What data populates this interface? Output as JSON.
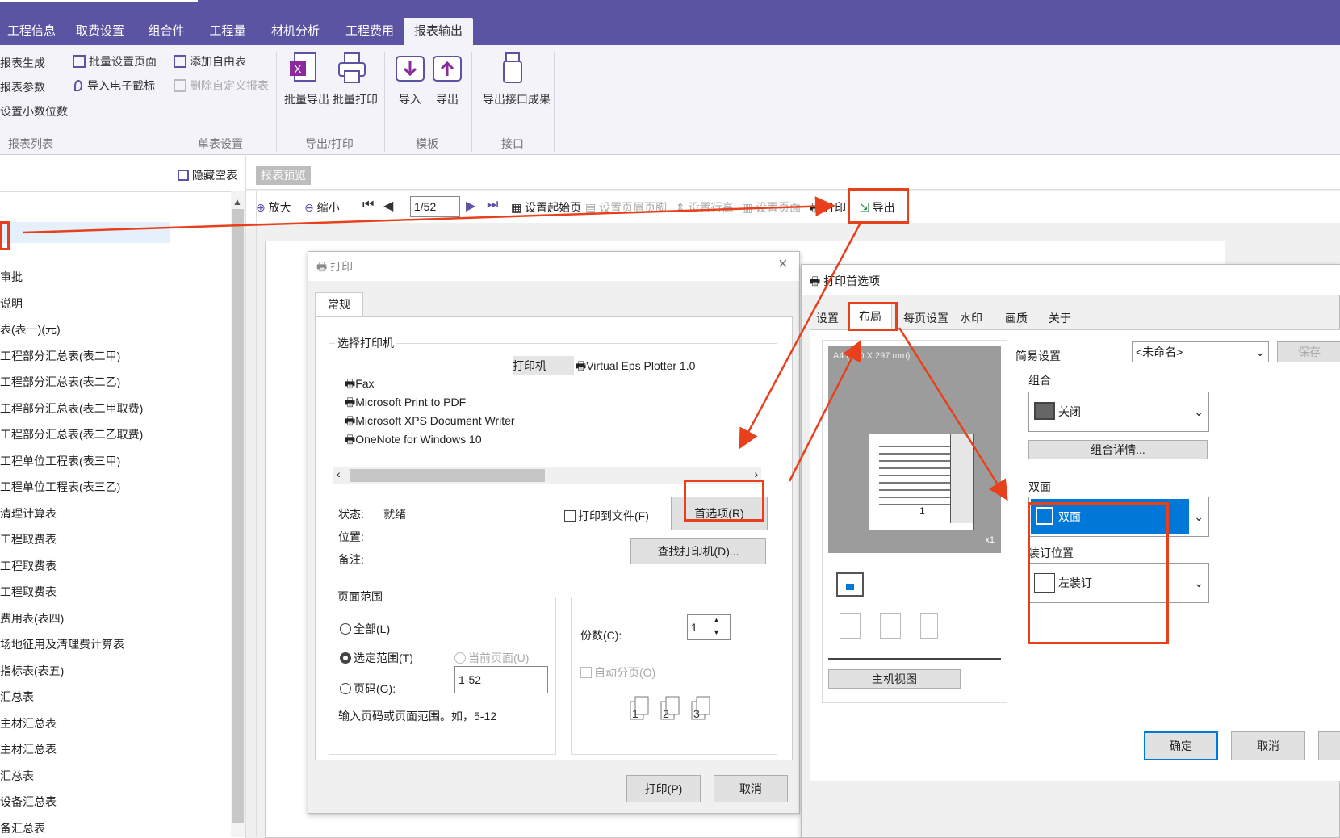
{
  "ribbon": {
    "tabs": [
      "工程信息",
      "取费设置",
      "组合件",
      "工程量",
      "材机分析",
      "工程费用",
      "报表输出"
    ],
    "active_tab": "报表输出",
    "group1_items": [
      "报表生成",
      "报表参数",
      "设置小数位数"
    ],
    "group1_label": "报表列表",
    "group2_items": [
      "批量设置页面",
      "导入电子截标",
      "添加自由表",
      "删除自定义报表"
    ],
    "group2_label": "单表设置",
    "export_print": {
      "batch_export": "批量导出",
      "batch_print": "批量打印",
      "label": "导出/打印"
    },
    "template": {
      "import": "导入",
      "export": "导出",
      "label": "模板"
    },
    "interface": {
      "export_result": "导出接口成果",
      "label": "接口"
    }
  },
  "left_panel": {
    "hide_empty": "隐藏空表",
    "items": [
      "审批",
      "说明",
      "表(表一)(元)",
      "工程部分汇总表(表二甲)",
      "工程部分汇总表(表二乙)",
      "工程部分汇总表(表二甲取费)",
      "工程部分汇总表(表二乙取费)",
      "工程单位工程表(表三甲)",
      "工程单位工程表(表三乙)",
      "清理计算表",
      "工程取费表",
      "工程取费表",
      "工程取费表",
      "费用表(表四)",
      "场地征用及清理费计算表",
      "指标表(表五)",
      "汇总表",
      "主材汇总表",
      "主材汇总表",
      "汇总表",
      "设备汇总表",
      "备汇总表"
    ]
  },
  "preview": {
    "tab": "报表预览",
    "toolbar": {
      "zoom_in": "放大",
      "zoom_out": "缩小",
      "page": "1/52",
      "set_start": "设置起始页",
      "set_header": "设置页眉页脚",
      "set_row": "设置行高",
      "set_page": "设置页面",
      "print": "打印",
      "export": "导出"
    }
  },
  "print_dialog": {
    "title": "打印",
    "tab": "常规",
    "select_printer": "选择打印机",
    "printers": [
      "Fax",
      "Microsoft Print to PDF",
      "Microsoft XPS Document Writer",
      "OneNote for Windows 10"
    ],
    "printer_header": "打印机",
    "virtual_printer": "Virtual Eps Plotter 1.0",
    "status_label": "状态:",
    "status_value": "就绪",
    "location_label": "位置:",
    "note_label": "备注:",
    "print_to_file": "打印到文件(F)",
    "preferences": "首选项(R)",
    "find_printer": "查找打印机(D)...",
    "page_range": "页面范围",
    "all": "全部(L)",
    "selection": "选定范围(T)",
    "current_page": "当前页面(U)",
    "pages": "页码(G):",
    "pages_value": "1-52",
    "hint": "输入页码或页面范围。如，5-12",
    "copies_label": "份数(C):",
    "copies_value": "1",
    "collate": "自动分页(O)",
    "print_btn": "打印(P)",
    "cancel_btn": "取消"
  },
  "pref_dialog": {
    "title": "打印首选项",
    "tabs": [
      "设置",
      "布局",
      "每页设置",
      "水印",
      "画质",
      "关于"
    ],
    "active_tab": "布局",
    "paper": "A4 (210 X 297 mm)",
    "copies_mark": "x1",
    "page_num": "1",
    "host_view": "主机视图",
    "easy_setting": "简易设置",
    "easy_value": "<未命名>",
    "save": "保存",
    "combine": "组合",
    "combine_value": "关闭",
    "combine_detail": "组合详情...",
    "duplex": "双面",
    "duplex_value": "双面",
    "binding": "装订位置",
    "binding_value": "左装订",
    "ok": "确定",
    "cancel": "取消"
  },
  "colors": {
    "ribbon_bg": "#5b54a2",
    "annotation": "#e8401c",
    "selected": "#0078d7"
  }
}
